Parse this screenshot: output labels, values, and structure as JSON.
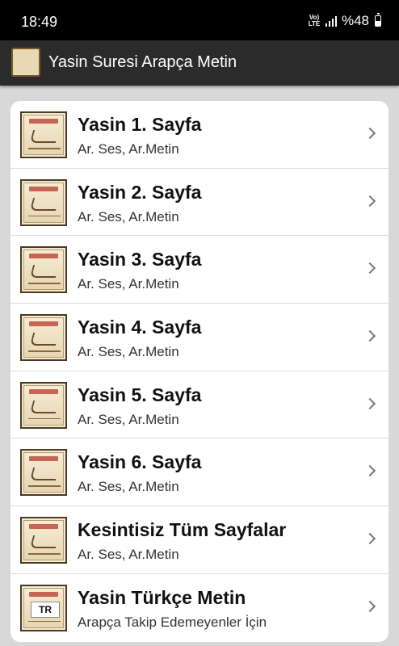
{
  "status_bar": {
    "time": "18:49",
    "volte_label": "Vo) LTE",
    "battery": "%48",
    "battery_level": 0.48
  },
  "app_bar": {
    "title": "Yasin Suresi Arapça Metin",
    "icon": "yasin-book-icon"
  },
  "list": {
    "items": [
      {
        "title": "Yasin 1. Sayfa",
        "subtitle": "Ar. Ses, Ar.Metin",
        "icon": "yasin-page-icon"
      },
      {
        "title": "Yasin 2. Sayfa",
        "subtitle": "Ar. Ses, Ar.Metin",
        "icon": "yasin-page-icon"
      },
      {
        "title": "Yasin 3. Sayfa",
        "subtitle": "Ar. Ses, Ar.Metin",
        "icon": "yasin-page-icon"
      },
      {
        "title": "Yasin 4. Sayfa",
        "subtitle": "Ar. Ses, Ar.Metin",
        "icon": "yasin-page-icon"
      },
      {
        "title": "Yasin 5. Sayfa",
        "subtitle": "Ar. Ses, Ar.Metin",
        "icon": "yasin-page-icon"
      },
      {
        "title": "Yasin 6. Sayfa",
        "subtitle": "Ar. Ses, Ar.Metin",
        "icon": "yasin-page-icon"
      },
      {
        "title": "Kesintisiz Tüm Sayfalar",
        "subtitle": "Ar. Ses, Ar.Metin",
        "icon": "yasin-page-icon"
      },
      {
        "title": "Yasin Türkçe Metin",
        "subtitle": "Arapça Takip Edemeyenler İçin",
        "icon": "yasin-turkish-icon",
        "badge": "TR"
      }
    ]
  },
  "colors": {
    "status_bar_bg": "#000000",
    "app_bar_bg": "#2b2b2b",
    "page_bg": "#d8d8d8",
    "card_bg": "#ffffff"
  }
}
